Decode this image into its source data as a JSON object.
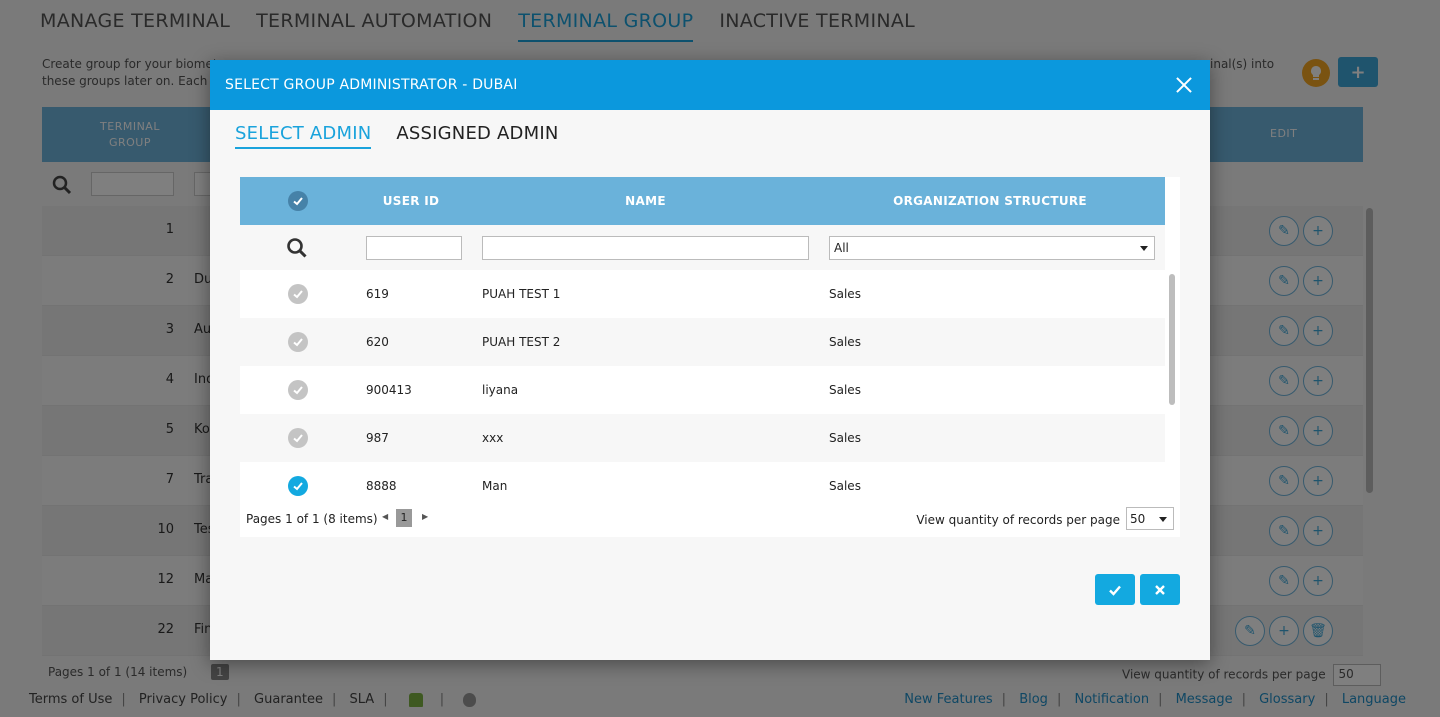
{
  "background": {
    "tabs": [
      "MANAGE TERMINAL",
      "TERMINAL AUTOMATION",
      "TERMINAL GROUP",
      "INACTIVE TERMINAL"
    ],
    "active_tab": 2,
    "description_left_1": "Create group for your biomet",
    "description_left_2": "these groups later on. Each g",
    "description_right": "inal(s) into",
    "table_header_group": "TERMINAL GROUP",
    "table_header_edit": "EDIT",
    "rows": [
      {
        "num": "1",
        "name": ""
      },
      {
        "num": "2",
        "name": "Du"
      },
      {
        "num": "3",
        "name": "Au"
      },
      {
        "num": "4",
        "name": "Ind"
      },
      {
        "num": "5",
        "name": "Ko"
      },
      {
        "num": "7",
        "name": "Tra"
      },
      {
        "num": "10",
        "name": "Tes"
      },
      {
        "num": "12",
        "name": "Ma"
      },
      {
        "num": "22",
        "name": "Fin"
      }
    ],
    "pager_info": "Pages 1 of 1 (14 items)",
    "pager_page": "1",
    "view_label": "View quantity of records per page",
    "view_value": "50"
  },
  "footer": {
    "left": [
      "Terms of Use",
      "Privacy Policy",
      "Guarantee",
      "SLA"
    ],
    "right": [
      "New Features",
      "Blog",
      "Notification",
      "Message",
      "Glossary",
      "Language"
    ]
  },
  "modal": {
    "title": "SELECT GROUP ADMINISTRATOR - DUBAI",
    "tabs": {
      "select": "SELECT ADMIN",
      "assigned": "ASSIGNED ADMIN"
    },
    "columns": {
      "user_id": "USER ID",
      "name": "NAME",
      "org": "ORGANIZATION STRUCTURE"
    },
    "filter": {
      "user_id": "",
      "name": "",
      "org": "All"
    },
    "rows": [
      {
        "user_id": "619",
        "name": "PUAH TEST 1",
        "org": "Sales",
        "checked": false
      },
      {
        "user_id": "620",
        "name": "PUAH TEST 2",
        "org": "Sales",
        "checked": false
      },
      {
        "user_id": "900413",
        "name": "liyana",
        "org": "Sales",
        "checked": false
      },
      {
        "user_id": "987",
        "name": "xxx",
        "org": "Sales",
        "checked": false
      },
      {
        "user_id": "8888",
        "name": "Man",
        "org": "Sales",
        "checked": true
      }
    ],
    "pager": {
      "info": "Pages 1 of 1 (8 items)",
      "page": "1",
      "view_label": "View quantity of records per page",
      "per_page": "50"
    }
  },
  "colors": {
    "accent": "#1aa3dc",
    "modal_header": "#0b98dd",
    "grid_header": "#6ab2da",
    "check_on": "#13a9e0",
    "check_off": "#c4c4c4"
  },
  "icons": [
    "lightbulb-icon",
    "plus-icon",
    "search-icon",
    "edit-icon",
    "add-user-icon",
    "delete-icon",
    "close-icon",
    "check-icon",
    "chevron-left-icon",
    "chevron-right-icon",
    "caret-down-icon",
    "android-icon",
    "apple-icon"
  ]
}
